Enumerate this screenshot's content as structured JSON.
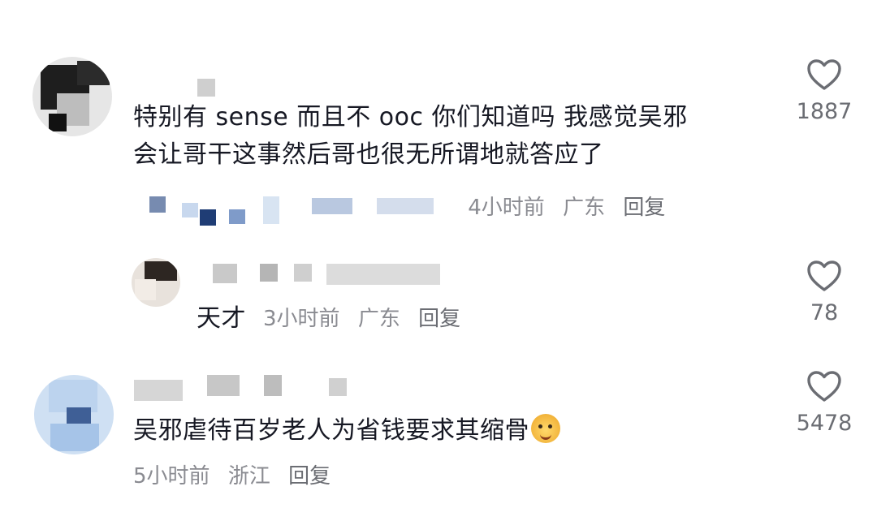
{
  "comments": [
    {
      "text_line1": "特别有 sense 而且不 ooc 你们知道吗 我感觉吴邪",
      "text_line2": "会让哥干这事然后哥也很无所谓地就答应了",
      "meta_time": "4小时前",
      "meta_location": "广东",
      "meta_reply": "回复",
      "like_count": "1887"
    },
    {
      "text": "天才",
      "meta_time": "3小时前",
      "meta_location": "广东",
      "meta_reply": "回复",
      "like_count": "78"
    },
    {
      "text": "吴邪虐待百岁老人为省钱要求其缩骨",
      "meta_time": "5小时前",
      "meta_location": "浙江",
      "meta_reply": "回复",
      "like_count": "5478"
    }
  ],
  "icons": {
    "like": "heart-outline-icon",
    "emoji": "smiling-face-emoji"
  },
  "colors": {
    "text": "#161823",
    "meta": "#8a8b91",
    "icon": "#6b6d73"
  }
}
